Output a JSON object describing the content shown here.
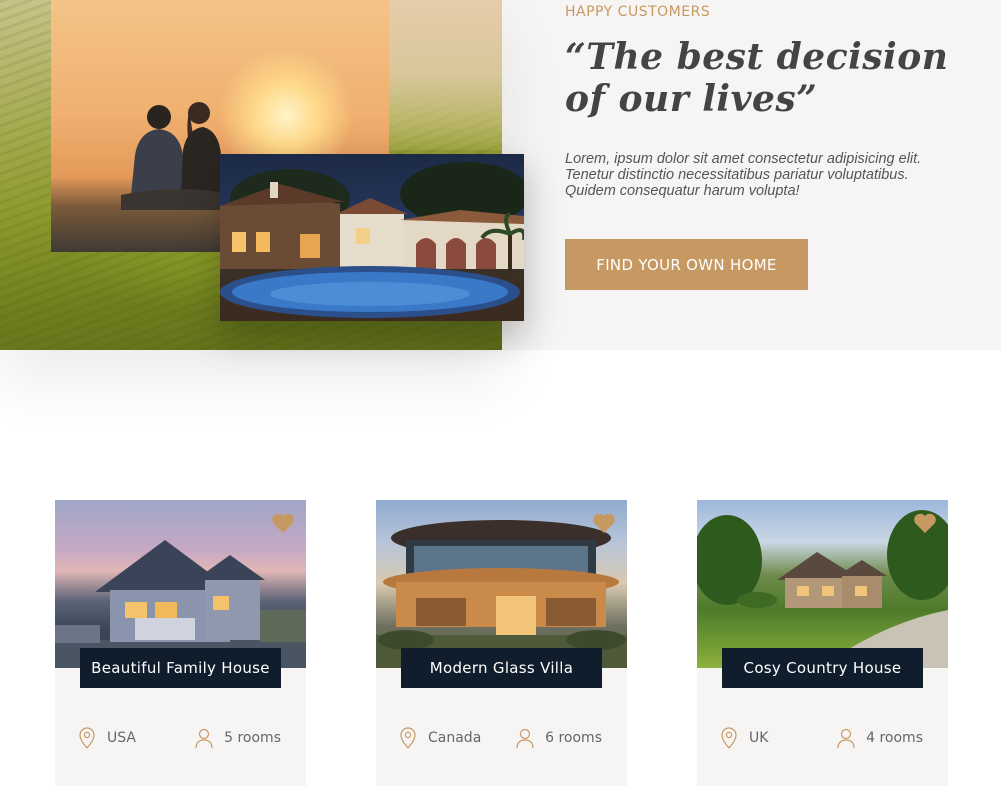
{
  "stories": {
    "label": "HAPPY CUSTOMERS",
    "title": "“The best decision of our lives”",
    "text": "Lorem, ipsum dolor sit amet consectetur adipisicing elit. Tenetur distinctio necessitatibus pariatur voluptatibus. Quidem consequatur harum volupta!",
    "button": "FIND YOUR OWN HOME"
  },
  "colors": {
    "accent": "#c69963",
    "dark": "#101d2c",
    "light_bg": "#f7f5f3"
  },
  "homes": [
    {
      "name": "Beautiful Family House",
      "location": "USA",
      "rooms": "5 rooms",
      "image": "family-house-photo"
    },
    {
      "name": "Modern Glass Villa",
      "location": "Canada",
      "rooms": "6 rooms",
      "image": "glass-villa-photo"
    },
    {
      "name": "Cosy Country House",
      "location": "UK",
      "rooms": "4 rooms",
      "image": "country-house-photo"
    }
  ],
  "icons": {
    "favorite": "heart-icon",
    "location": "map-pin-icon",
    "rooms": "user-icon"
  }
}
